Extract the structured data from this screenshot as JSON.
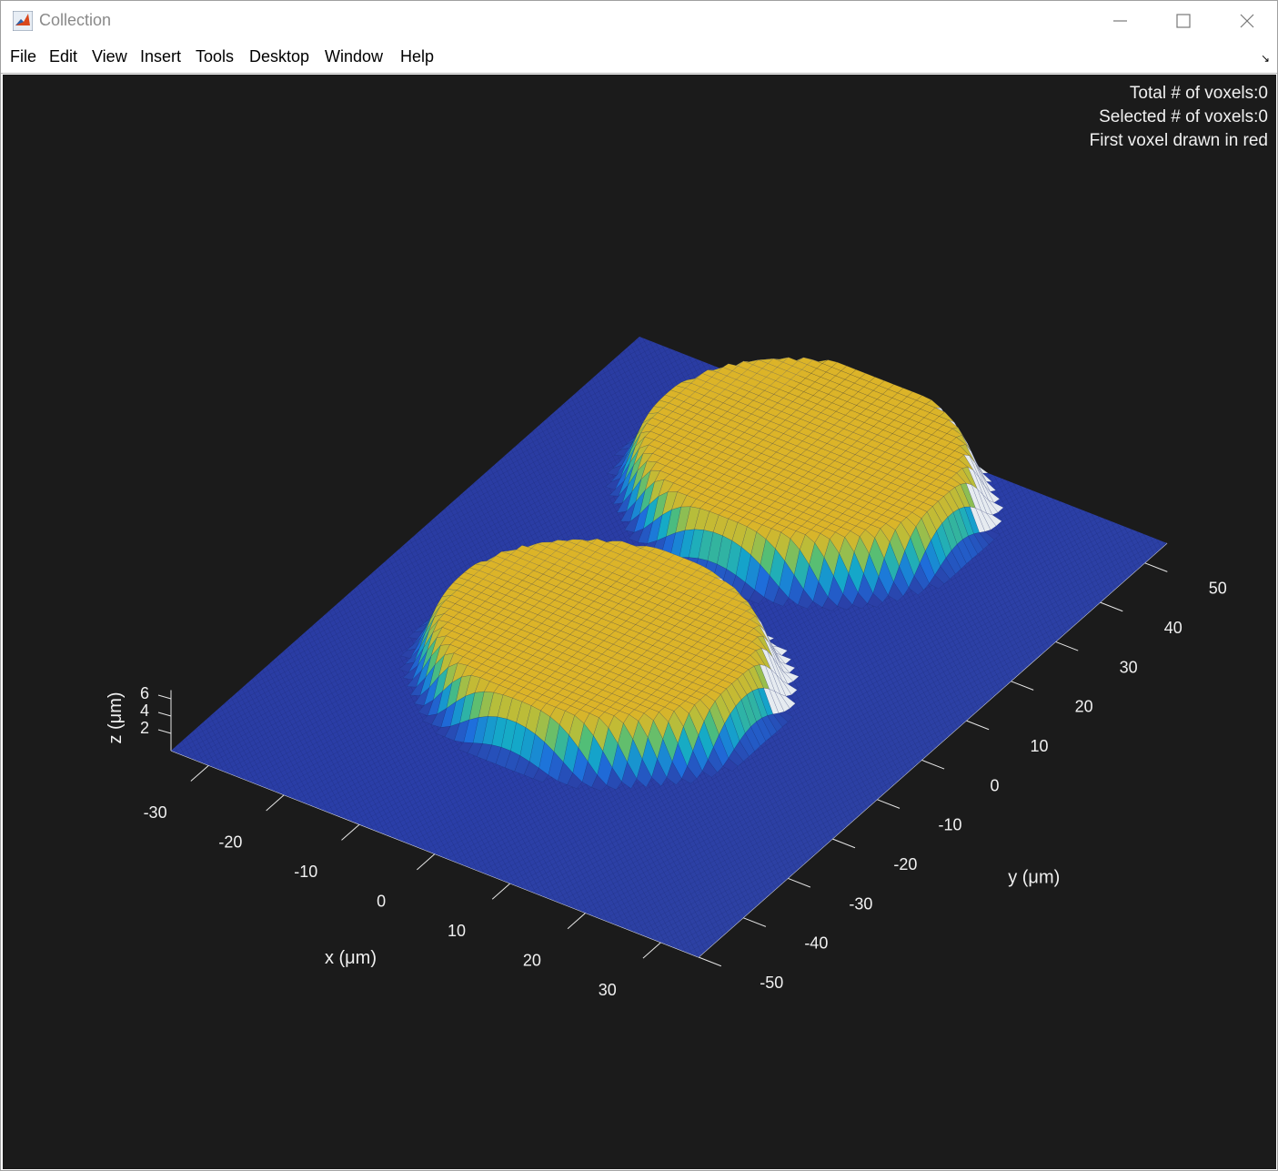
{
  "window": {
    "title": "Collection",
    "icon": "matlab-icon",
    "controls": [
      "minimize-icon",
      "maximize-icon",
      "close-icon"
    ]
  },
  "menu": [
    "File",
    "Edit",
    "View",
    "Insert",
    "Tools",
    "Desktop",
    "Window",
    "Help"
  ],
  "info": {
    "total": "Total # of voxels:0",
    "selected": "Selected # of voxels:0",
    "first": "First voxel drawn in red"
  },
  "colors": {
    "figure_background": "#1b1b1b",
    "surface_low": "#2a3a9e",
    "surface_high": "#d4b020",
    "text": "#f0f0f0"
  },
  "chart_data": {
    "type": "surface",
    "colormap": "parula",
    "xlabel": "x (μm)",
    "ylabel": "y (μm)",
    "zlabel": "z (μm)",
    "xlim": [
      -35,
      35
    ],
    "ylim": [
      -50,
      55
    ],
    "zlim": [
      0,
      7
    ],
    "x_ticks": [
      -30,
      -20,
      -10,
      0,
      10,
      20,
      30
    ],
    "y_ticks": [
      -50,
      -40,
      -30,
      -20,
      -10,
      0,
      10,
      20,
      30,
      40,
      50
    ],
    "z_ticks": [
      2,
      4,
      6
    ],
    "features": [
      {
        "shape": "dome",
        "center_x": -3,
        "center_y": -8,
        "radius": 20,
        "height": 6
      },
      {
        "shape": "dome",
        "center_x": -3,
        "center_y": 38,
        "radius": 20,
        "height": 6
      }
    ]
  }
}
